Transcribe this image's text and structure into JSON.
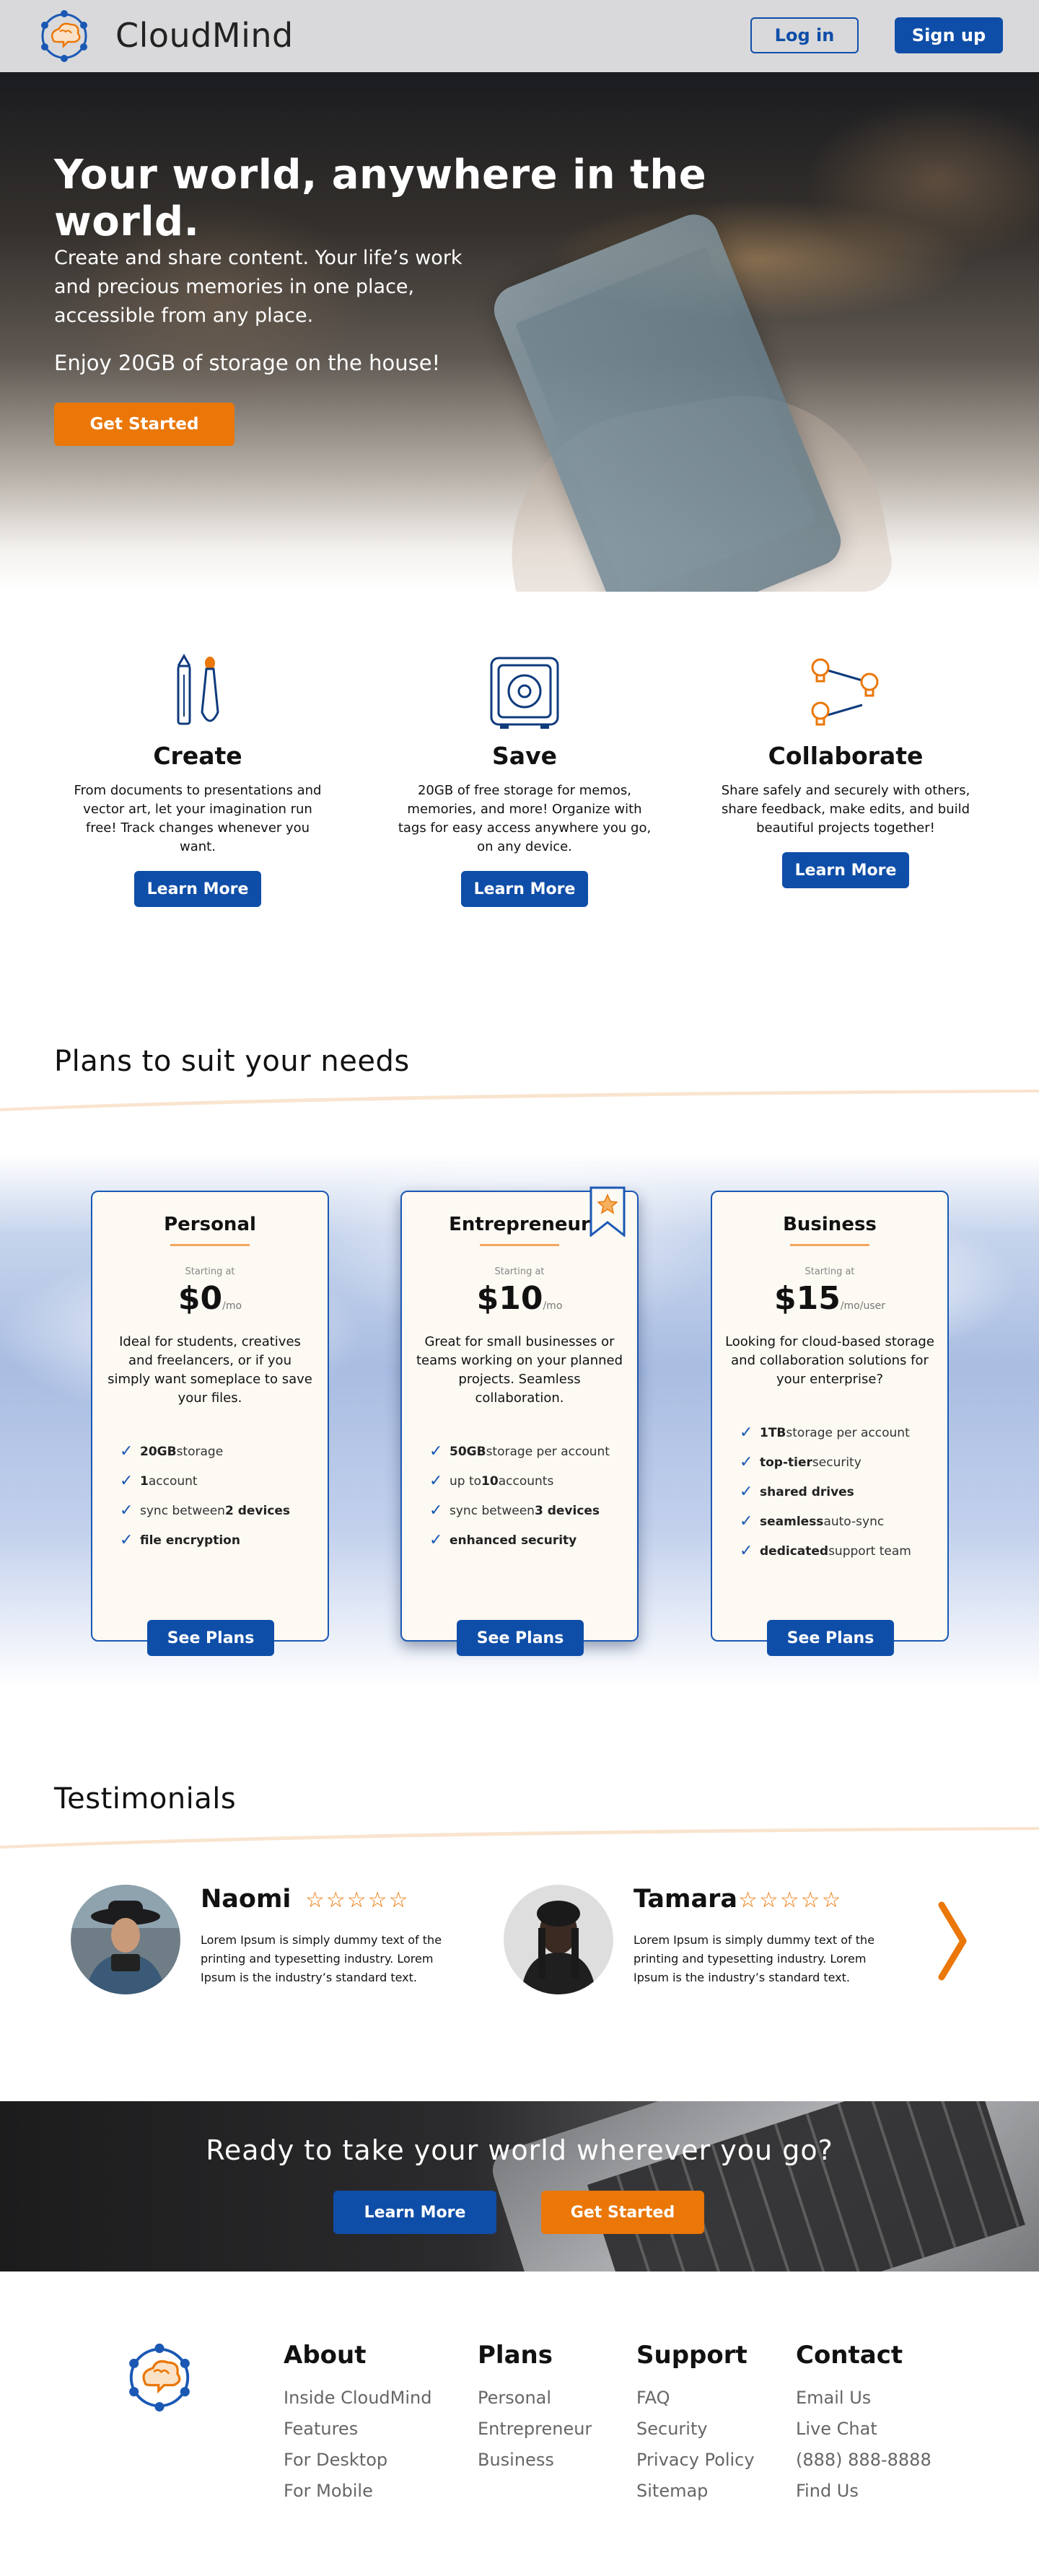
{
  "nav": {
    "brand": "CloudMind",
    "login": "Log in",
    "signup": "Sign up"
  },
  "hero": {
    "title": "Your world, anywhere in the world.",
    "subtitle": "Create and share content. Your life’s work and precious memories in one place, accessible from any place.",
    "free": "Enjoy 20GB of storage on the house!",
    "cta": "Get Started"
  },
  "features": [
    {
      "title": "Create",
      "text": "From documents to presentations and vector art, let your imagination run free! Track changes whenever you want.",
      "button": "Learn More",
      "icon": "pencil-brush-icon"
    },
    {
      "title": "Save",
      "text": "20GB of free storage for memos, memories, and more! Organize with tags for easy access anywhere you go, on any device.",
      "button": "Learn More",
      "icon": "safe-icon"
    },
    {
      "title": "Collaborate",
      "text": "Share safely and securely with others, share feedback, make edits, and build beautiful projects together!",
      "button": "Learn More",
      "icon": "lightbulb-network-icon"
    }
  ],
  "plans_section": {
    "title": "Plans to suit your needs"
  },
  "plans": [
    {
      "name": "Personal",
      "starting": "Starting at",
      "price": "$0",
      "per": "/mo",
      "desc": "Ideal for students, creatives and freelancers, or if you simply want someplace to save your files.",
      "features": [
        [
          "20GB",
          " storage"
        ],
        [
          "1",
          " account"
        ],
        [
          "sync between ",
          "2 devices"
        ],
        [
          "file encryption",
          ""
        ]
      ],
      "button": "See Plans"
    },
    {
      "name": "Entrepreneur",
      "starting": "Starting at",
      "price": "$10",
      "per": "/mo",
      "desc": "Great for small businesses or teams working on your planned projects. Seamless collaboration.",
      "features": [
        [
          "50GB",
          " storage per account"
        ],
        [
          "up to ",
          "10",
          " accounts"
        ],
        [
          "sync between ",
          "3 devices"
        ],
        [
          "enhanced security",
          ""
        ]
      ],
      "button": "See Plans"
    },
    {
      "name": "Business",
      "starting": "Starting at",
      "price": "$15",
      "per": "/mo/user",
      "desc": "Looking for cloud-based storage and collaboration solutions for your enterprise?",
      "features": [
        [
          "1TB",
          " storage per account"
        ],
        [
          "top-tier",
          " security"
        ],
        [
          "shared drives",
          ""
        ],
        [
          "seamless",
          " auto-sync"
        ],
        [
          "dedicated",
          " support team"
        ]
      ],
      "button": "See Plans"
    }
  ],
  "testimonials_section": {
    "title": "Testimonials"
  },
  "testimonials": [
    {
      "name": "Naomi",
      "stars": "☆☆☆☆☆",
      "rating": 5,
      "quote": "Lorem Ipsum is simply dummy text of the printing and typesetting industry. Lorem Ipsum is the industry’s standard text."
    },
    {
      "name": "Tamara",
      "stars": "☆☆☆☆☆",
      "rating": 4.5,
      "quote": "Lorem Ipsum is simply dummy text of the printing and typesetting industry. Lorem Ipsum is the industry’s standard text."
    }
  ],
  "band": {
    "title": "Ready to take your world wherever you go?",
    "learn": "Learn More",
    "start": "Get Started"
  },
  "footer": [
    {
      "title": "About",
      "links": [
        "Inside CloudMind",
        "Features",
        "For Desktop",
        "For Mobile"
      ]
    },
    {
      "title": "Plans",
      "links": [
        "Personal",
        "Entrepreneur",
        "Business"
      ]
    },
    {
      "title": "Support",
      "links": [
        "FAQ",
        "Security",
        "Privacy Policy",
        "Sitemap"
      ]
    },
    {
      "title": "Contact",
      "links": [
        "Email Us",
        "Live Chat",
        "(888) 888-8888",
        "Find Us"
      ]
    }
  ],
  "colors": {
    "primary": "#0f4ea8",
    "accent": "#ea7708",
    "nav_bg": "#d9d9db"
  }
}
